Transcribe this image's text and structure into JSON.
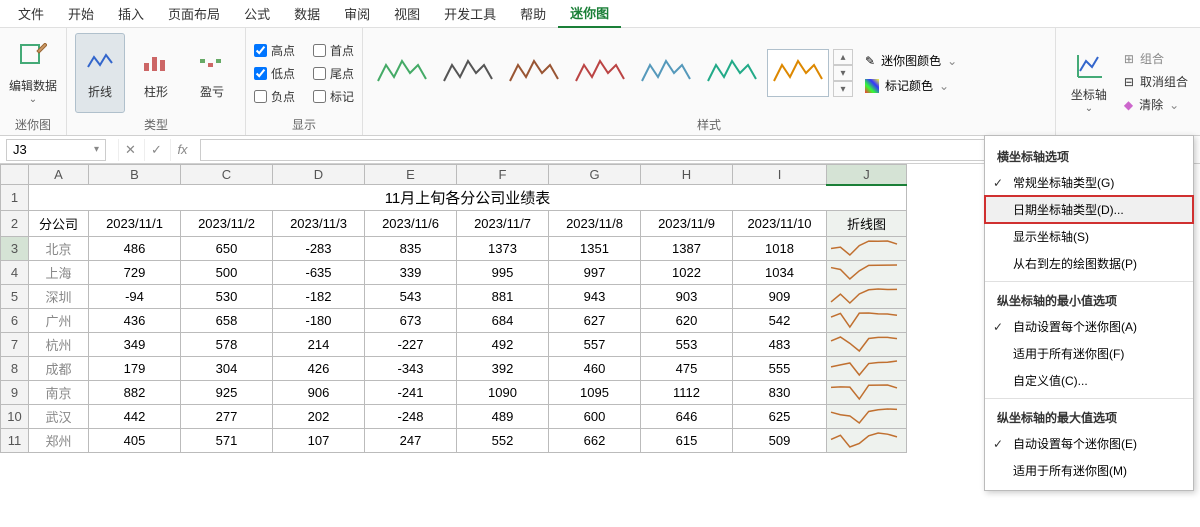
{
  "menubar": [
    "文件",
    "开始",
    "插入",
    "页面布局",
    "公式",
    "数据",
    "审阅",
    "视图",
    "开发工具",
    "帮助",
    "迷你图"
  ],
  "menubar_active": 10,
  "ribbon": {
    "edit": {
      "label": "编辑数据",
      "group": "迷你图"
    },
    "types": {
      "group": "类型",
      "items": [
        "折线",
        "柱形",
        "盈亏"
      ],
      "selected": 0
    },
    "display": {
      "group": "显示",
      "row1": [
        "高点",
        "首点"
      ],
      "row2": [
        "低点",
        "尾点"
      ],
      "row3": [
        "负点",
        "标记"
      ],
      "checked": [
        "高点",
        "低点"
      ]
    },
    "styles": {
      "group": "样式"
    },
    "color": {
      "spark": "迷你图颜色",
      "marker": "标记颜色"
    },
    "axis": {
      "label": "坐标轴"
    },
    "grouping": {
      "combine": "组合",
      "ungroup": "取消组合",
      "clear": "清除"
    }
  },
  "namebox": "J3",
  "dropdown": {
    "sect1": "横坐标轴选项",
    "items1": [
      {
        "label": "常规坐标轴类型(G)",
        "checked": true
      },
      {
        "label": "日期坐标轴类型(D)...",
        "highlight": true
      },
      {
        "label": "显示坐标轴(S)"
      },
      {
        "label": "从右到左的绘图数据(P)"
      }
    ],
    "sect2": "纵坐标轴的最小值选项",
    "items2": [
      {
        "label": "自动设置每个迷你图(A)",
        "checked": true
      },
      {
        "label": "适用于所有迷你图(F)"
      },
      {
        "label": "自定义值(C)..."
      }
    ],
    "sect3": "纵坐标轴的最大值选项",
    "items3": [
      {
        "label": "自动设置每个迷你图(E)",
        "checked": true
      },
      {
        "label": "适用于所有迷你图(M)"
      }
    ]
  },
  "table": {
    "title": "11月上旬各分公司业绩表",
    "columns": [
      "分公司",
      "2023/11/1",
      "2023/11/2",
      "2023/11/3",
      "2023/11/6",
      "2023/11/7",
      "2023/11/8",
      "2023/11/9",
      "2023/11/10",
      "折线图"
    ],
    "colLetters": [
      "A",
      "B",
      "C",
      "D",
      "E",
      "F",
      "G",
      "H",
      "I",
      "J"
    ],
    "rows": [
      [
        "北京",
        486,
        650,
        -283,
        835,
        1373,
        1351,
        1387,
        1018
      ],
      [
        "上海",
        729,
        500,
        -635,
        339,
        995,
        997,
        1022,
        1034
      ],
      [
        "深圳",
        -94,
        530,
        -182,
        543,
        881,
        943,
        903,
        909
      ],
      [
        "广州",
        436,
        658,
        -180,
        673,
        684,
        627,
        620,
        542
      ],
      [
        "杭州",
        349,
        578,
        214,
        -227,
        492,
        557,
        553,
        483
      ],
      [
        "成都",
        179,
        304,
        426,
        -343,
        392,
        460,
        475,
        555
      ],
      [
        "南京",
        882,
        925,
        906,
        -241,
        1090,
        1095,
        1112,
        830
      ],
      [
        "武汉",
        442,
        277,
        202,
        -248,
        489,
        600,
        646,
        625
      ],
      [
        "郑州",
        405,
        571,
        107,
        247,
        552,
        662,
        615,
        509
      ]
    ]
  },
  "chart_data": {
    "type": "table",
    "title": "11月上旬各分公司业绩表",
    "columns": [
      "分公司",
      "2023/11/1",
      "2023/11/2",
      "2023/11/3",
      "2023/11/6",
      "2023/11/7",
      "2023/11/8",
      "2023/11/9",
      "2023/11/10"
    ],
    "rows": [
      [
        "北京",
        486,
        650,
        -283,
        835,
        1373,
        1351,
        1387,
        1018
      ],
      [
        "上海",
        729,
        500,
        -635,
        339,
        995,
        997,
        1022,
        1034
      ],
      [
        "深圳",
        -94,
        530,
        -182,
        543,
        881,
        943,
        903,
        909
      ],
      [
        "广州",
        436,
        658,
        -180,
        673,
        684,
        627,
        620,
        542
      ],
      [
        "杭州",
        349,
        578,
        214,
        -227,
        492,
        557,
        553,
        483
      ],
      [
        "成都",
        179,
        304,
        426,
        -343,
        392,
        460,
        475,
        555
      ],
      [
        "南京",
        882,
        925,
        906,
        -241,
        1090,
        1095,
        1112,
        830
      ],
      [
        "武汉",
        442,
        277,
        202,
        -248,
        489,
        600,
        646,
        625
      ],
      [
        "郑州",
        405,
        571,
        107,
        247,
        552,
        662,
        615,
        509
      ]
    ],
    "sparkline_type": "line"
  }
}
